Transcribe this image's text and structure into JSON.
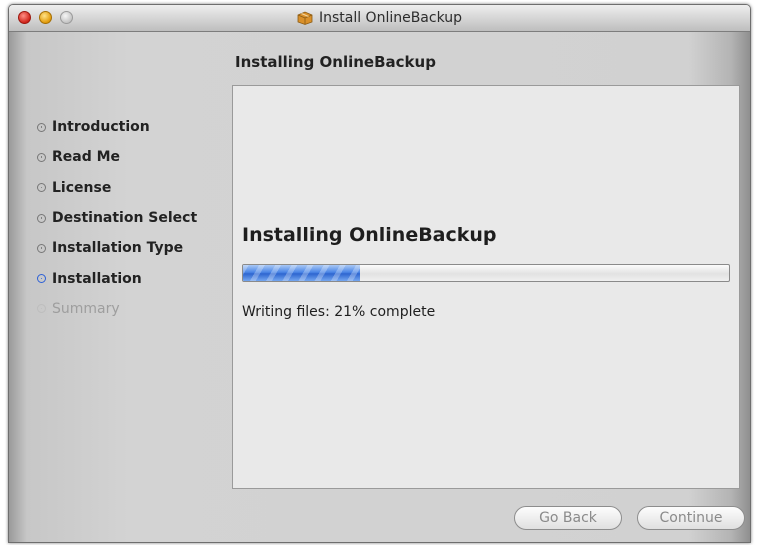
{
  "window": {
    "title": "Install OnlineBackup"
  },
  "page": {
    "title": "Installing OnlineBackup"
  },
  "steps": [
    {
      "label": "Introduction",
      "state": "done"
    },
    {
      "label": "Read Me",
      "state": "done"
    },
    {
      "label": "License",
      "state": "done"
    },
    {
      "label": "Destination Select",
      "state": "done"
    },
    {
      "label": "Installation Type",
      "state": "done"
    },
    {
      "label": "Installation",
      "state": "current"
    },
    {
      "label": "Summary",
      "state": "future"
    }
  ],
  "main": {
    "heading": "Installing OnlineBackup",
    "status": "Writing files: 21% complete",
    "progress": 0.24
  },
  "buttons": {
    "back": "Go Back",
    "continue": "Continue"
  },
  "colors": {
    "progress": "#3a74dc",
    "current_step": "#2d60d6"
  },
  "icons": {
    "title": "package-icon"
  }
}
